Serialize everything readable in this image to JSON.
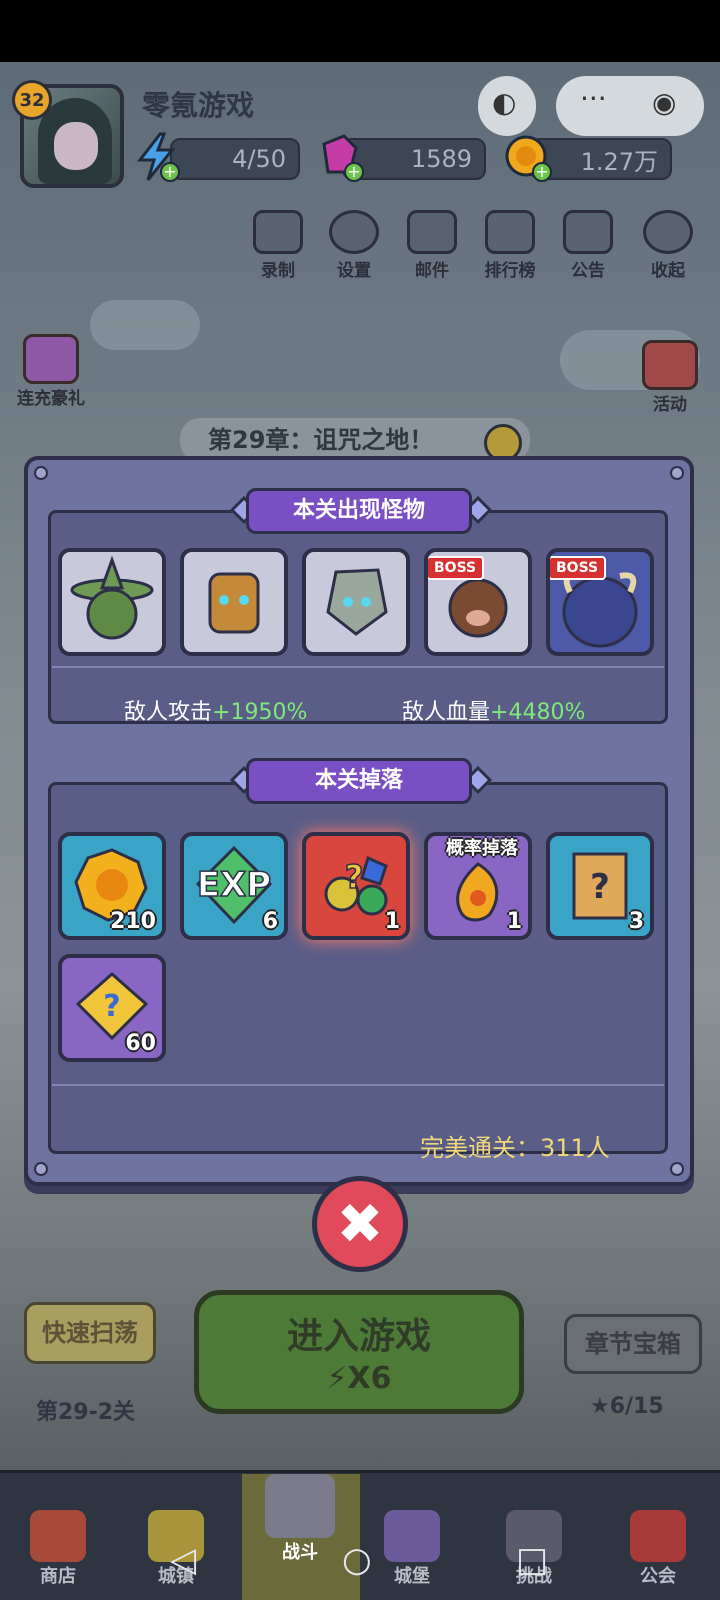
{
  "header": {
    "level": "32",
    "username": "零氪游戏",
    "energy": "4/50",
    "gems": "1589",
    "gold": "1.27万"
  },
  "toolbar": [
    {
      "label": "录制"
    },
    {
      "label": "设置"
    },
    {
      "label": "邮件"
    },
    {
      "label": "排行榜"
    },
    {
      "label": "公告"
    },
    {
      "label": "收起"
    }
  ],
  "side_left": {
    "recharge_label": "连充豪礼"
  },
  "side_right": {
    "event_label": "活动"
  },
  "chapter_title": "第29章：诅咒之地！",
  "modal": {
    "monsters_title": "本关出现怪物",
    "monsters": [
      {
        "name": "green-lantern-ghost",
        "boss": false
      },
      {
        "name": "tree-golem",
        "boss": false
      },
      {
        "name": "stone-golem",
        "boss": false
      },
      {
        "name": "boar-beast",
        "boss": true
      },
      {
        "name": "horned-demon",
        "boss": true
      }
    ],
    "boss_label": "BOSS",
    "enemy_attack_label": "敌人攻击",
    "enemy_attack_value": "+1950%",
    "enemy_hp_label": "敌人血量",
    "enemy_hp_value": "+4480%",
    "drops_title": "本关掉落",
    "drops": [
      {
        "name": "gold-coin",
        "qty": "210"
      },
      {
        "name": "exp-gem",
        "qty": "6"
      },
      {
        "name": "random-gem-bag",
        "qty": "1"
      },
      {
        "name": "flame-emblem",
        "qty": "1"
      },
      {
        "name": "mystery-scroll",
        "qty": "3"
      },
      {
        "name": "mystery-puzzle-piece",
        "qty": "60"
      }
    ],
    "exp_text": "EXP",
    "chance_drop_label": "概率掉落",
    "perfect_clear": "完美通关：311人"
  },
  "bottom": {
    "sweep_label": "快速扫荡",
    "sweep_stage": "第29-2关",
    "enter_label": "进入游戏",
    "enter_cost": "X6",
    "chest_label": "章节宝箱",
    "chest_progress": "6/15"
  },
  "nav": [
    {
      "label": "商店"
    },
    {
      "label": "城镇"
    },
    {
      "label": "战斗"
    },
    {
      "label": "城堡"
    },
    {
      "label": "挑战"
    },
    {
      "label": "公会"
    }
  ],
  "colors": {
    "modal": "#6f73a0",
    "ribbon": "#7b4fc4",
    "positive_pct": "#7fe87b",
    "close_button": "#e04a5a"
  }
}
